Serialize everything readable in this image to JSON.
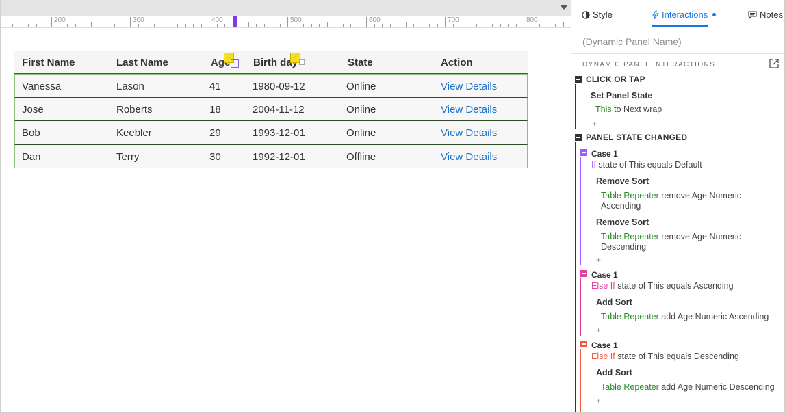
{
  "ruler": {
    "labels": [
      "200",
      "300",
      "400",
      "500",
      "600",
      "700",
      "800"
    ]
  },
  "table": {
    "headers": [
      "First Name",
      "Last Name",
      "Age",
      "Birth day",
      "State",
      "Action"
    ],
    "rows": [
      [
        "Vanessa",
        "Lason",
        "41",
        "1980-09-12",
        "Online",
        "View Details"
      ],
      [
        "Jose",
        "Roberts",
        "18",
        "2004-11-12",
        "Online",
        "View Details"
      ],
      [
        "Bob",
        "Keebler",
        "29",
        "1993-12-01",
        "Online",
        "View Details"
      ],
      [
        "Dan",
        "Terry",
        "30",
        "1992-12-01",
        "Offline",
        "View Details"
      ]
    ]
  },
  "panel": {
    "tabs": {
      "style": "Style",
      "interactions": "Interactions",
      "notes": "Notes"
    },
    "name_placeholder": "(Dynamic Panel Name)",
    "section_title": "DYNAMIC PANEL INTERACTIONS",
    "events": {
      "click": {
        "label": "CLICK OR TAP",
        "action": "Set Panel State",
        "target": "This",
        "detail": " to Next wrap"
      },
      "state_changed": {
        "label": "PANEL STATE CHANGED",
        "cases": [
          {
            "name": "Case 1",
            "keyword": "If",
            "condition": " state of This equals Default",
            "color": "#a259ff",
            "actions": [
              {
                "label": "Remove Sort",
                "target": "Table Repeater",
                "detail1": " remove Age Numeric",
                "detail2": "Ascending"
              },
              {
                "label": "Remove Sort",
                "target": "Table Repeater",
                "detail1": " remove Age Numeric",
                "detail2": "Descending"
              }
            ]
          },
          {
            "name": "Case 1",
            "keyword": "Else If",
            "condition": " state of This equals Ascending",
            "color": "#e23fa4",
            "actions": [
              {
                "label": "Add Sort",
                "target": "Table Repeater",
                "detail1": " add Age Numeric Ascending"
              }
            ]
          },
          {
            "name": "Case 1",
            "keyword": "Else If",
            "condition": " state of This equals Descending",
            "color": "#f05a3c",
            "actions": [
              {
                "label": "Add Sort",
                "target": "Table Repeater",
                "detail1": " add Age Numeric Descending"
              }
            ]
          }
        ]
      }
    },
    "plus": "+"
  },
  "colors": {
    "accent": "#1a73e8",
    "link": "#1a73c9",
    "action_target": "#2b8a2b",
    "ruler_marker": "#7b3fe4",
    "trigger": "#f5e31b"
  }
}
